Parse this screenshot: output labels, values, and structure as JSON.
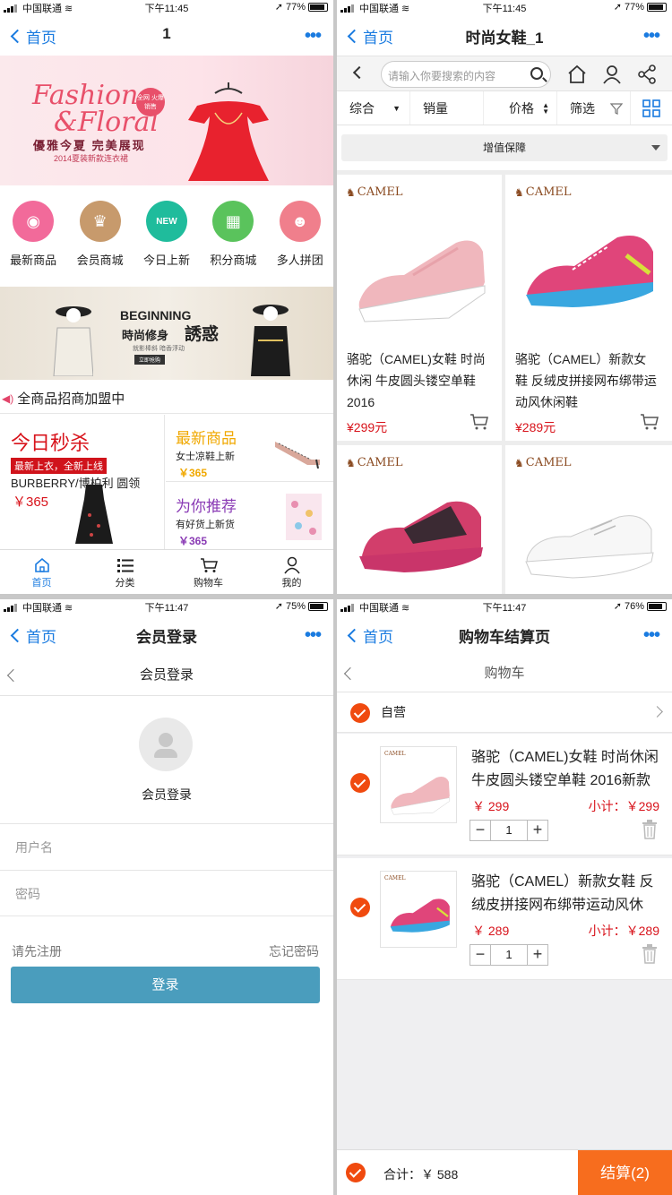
{
  "status": [
    {
      "carrier": "中国联通",
      "time": "下午11:45",
      "battery": "77%"
    },
    {
      "carrier": "中国联通",
      "time": "下午11:45",
      "battery": "77%"
    },
    {
      "carrier": "中国联通",
      "time": "下午11:47",
      "battery": "75%"
    },
    {
      "carrier": "中国联通",
      "time": "下午11:47",
      "battery": "76%"
    }
  ],
  "home": {
    "back": "首页",
    "title": "1",
    "more": "•••",
    "banner": {
      "title1": "Fashion",
      "title2": "&Floral",
      "badge": "全网 火爆销售",
      "slogan": "優雅今夏 完美展现",
      "sub": "2014夏装新款连衣裙"
    },
    "icons": [
      {
        "label": "最新商品",
        "color": "#f26a9a"
      },
      {
        "label": "会员商城",
        "color": "#c79a6c"
      },
      {
        "label": "今日上新",
        "color": "#1fbc9c"
      },
      {
        "label": "积分商城",
        "color": "#5ac35c"
      },
      {
        "label": "多人拼团",
        "color": "#f07f8c"
      }
    ],
    "banner2": {
      "title": "BEGINNING",
      "line": "時尚修身",
      "big": "誘惑",
      "sub": "就影棒斜 暗香浮动",
      "btn": "立即抢购"
    },
    "notice": "全商品招商加盟中",
    "flash": {
      "title": "今日秒杀",
      "tag": "最新上衣，全新上线",
      "brand": "BURBERRY/博柏利 圆领",
      "price": "￥365"
    },
    "new": {
      "title": "最新商品",
      "sub": "女士凉鞋上新",
      "price": "￥365"
    },
    "rec": {
      "title": "为你推荐",
      "sub": "有好货上新货",
      "price": "￥365"
    },
    "tabs": [
      "首页",
      "分类",
      "购物车",
      "我的"
    ]
  },
  "list": {
    "back": "首页",
    "title": "时尚女鞋_1",
    "more": "•••",
    "search_placeholder": "请输入你要搜索的内容",
    "sort": [
      "综合",
      "销量",
      "价格",
      "筛选"
    ],
    "guarantee": "增值保障",
    "brand": "CAMEL",
    "products": [
      {
        "title": "骆驼（CAMEL)女鞋 时尚休闲 牛皮圆头镂空单鞋 2016",
        "price": "¥299元",
        "color": "#f0b7bd"
      },
      {
        "title": "骆驼（CAMEL）新款女鞋 反绒皮拼接网布绑带运动风休闲鞋",
        "price": "¥289元",
        "color": "#e0457a"
      },
      {
        "title": "",
        "price": "",
        "color": "#d23e6b"
      },
      {
        "title": "",
        "price": "",
        "color": "#f2f2f2"
      }
    ]
  },
  "login": {
    "back": "首页",
    "title": "会员登录",
    "more": "•••",
    "subtitle": "会员登录",
    "avatar_label": "会员登录",
    "username_ph": "用户名",
    "password_ph": "密码",
    "register": "请先注册",
    "forgot": "忘记密码",
    "submit": "登录"
  },
  "cart": {
    "back": "首页",
    "title": "购物车结算页",
    "more": "•••",
    "subtitle": "购物车",
    "shop": "自营",
    "items": [
      {
        "title": "骆驼（CAMEL)女鞋 时尚休闲牛皮圆头镂空单鞋 2016新款",
        "price": "￥ 299",
        "subtotal": "小计：￥299",
        "qty": "1",
        "color": "#f0b7bd"
      },
      {
        "title": "骆驼（CAMEL）新款女鞋 反绒皮拼接网布绑带运动风休",
        "price": "￥ 289",
        "subtotal": "小计：￥289",
        "qty": "1",
        "color": "#e0457a"
      }
    ],
    "total": "合计：￥ 588",
    "checkout": "结算(2)"
  }
}
